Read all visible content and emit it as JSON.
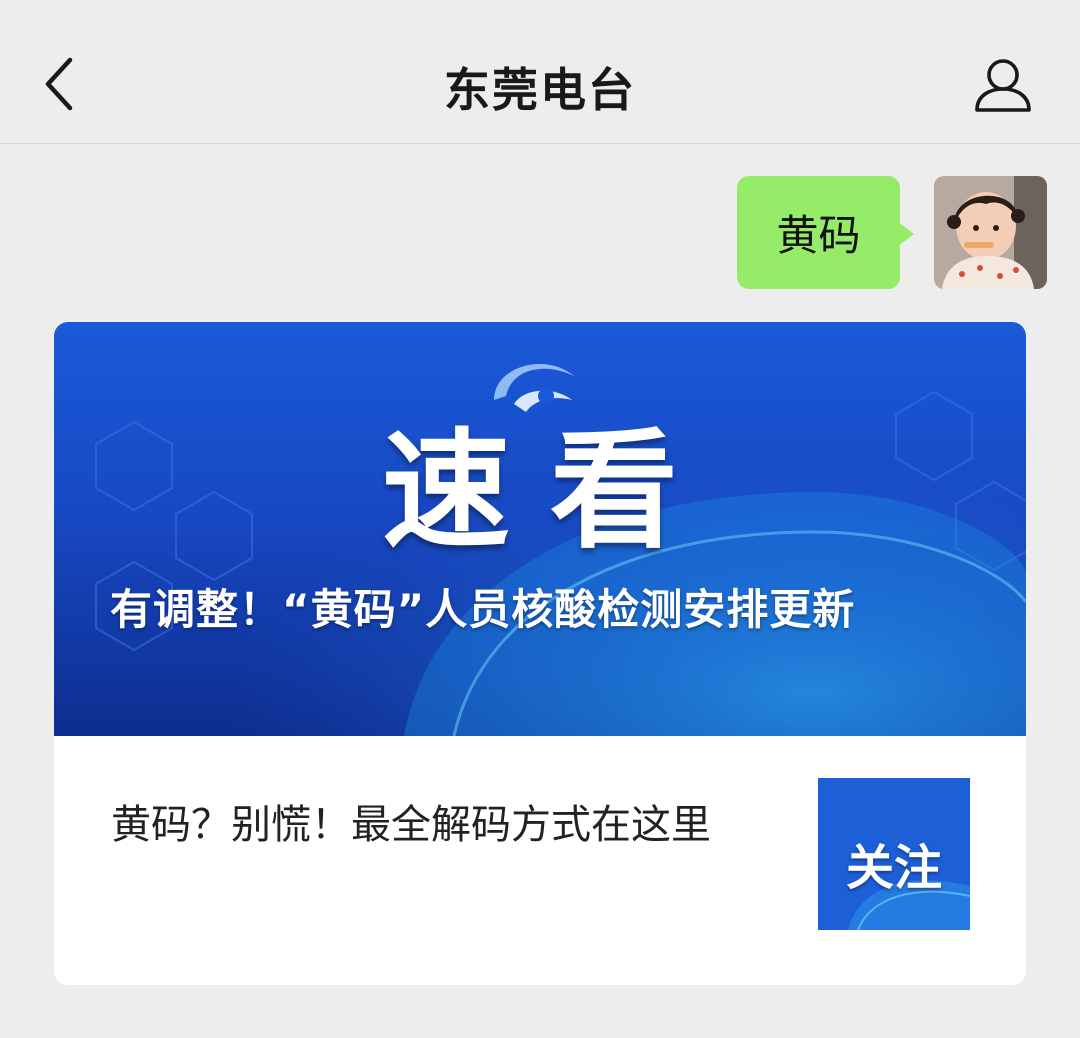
{
  "header": {
    "title": "东莞电台",
    "back_icon": "chevron-left-icon",
    "profile_icon": "person-icon"
  },
  "chat": {
    "message_text": "黄码",
    "bubble_color": "#95ec69",
    "avatar_icon": "user-avatar"
  },
  "article_card": {
    "cover_brand_text": "速看",
    "cover_headline": "有调整！“黄码”人员核酸检测安排更新",
    "summary": "黄码？别慌！最全解码方式在这里",
    "thumbnail_text": "关注",
    "cover_color": "#1a5ad8"
  }
}
